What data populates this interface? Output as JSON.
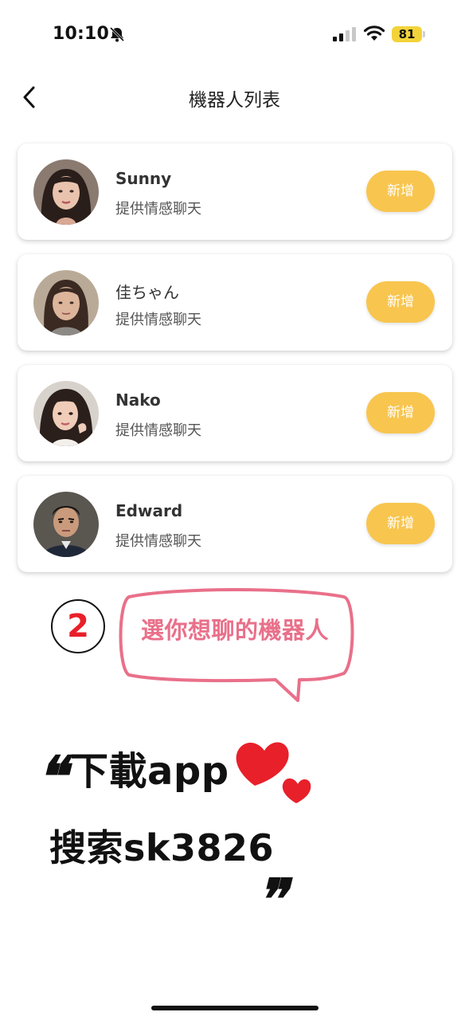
{
  "status_bar": {
    "time": "10:10",
    "battery": "81",
    "battery_color": "#f3d33a"
  },
  "header": {
    "title": "機器人列表",
    "back_icon": "chevron-left-icon"
  },
  "bots": [
    {
      "name": "Sunny",
      "description": "提供情感聊天",
      "action_label": "新增",
      "avatar_icon": "avatar-woman"
    },
    {
      "name": "佳ちゃん",
      "description": "提供情感聊天",
      "action_label": "新增",
      "avatar_icon": "avatar-woman"
    },
    {
      "name": "Nako",
      "description": "提供情感聊天",
      "action_label": "新增",
      "avatar_icon": "avatar-woman"
    },
    {
      "name": "Edward",
      "description": "提供情感聊天",
      "action_label": "新增",
      "avatar_icon": "avatar-man"
    }
  ],
  "annotation": {
    "step_number": "2",
    "bubble_text": "選你想聊的機器人",
    "bubble_color": "#e9708a",
    "step_color": "#e8202a"
  },
  "promo": {
    "open_quote": "❝",
    "line1": "下載app",
    "line2": "搜索sk3826",
    "close_quote": "❞",
    "heart_color": "#e8202a"
  },
  "colors": {
    "accent": "#f8c54f"
  }
}
